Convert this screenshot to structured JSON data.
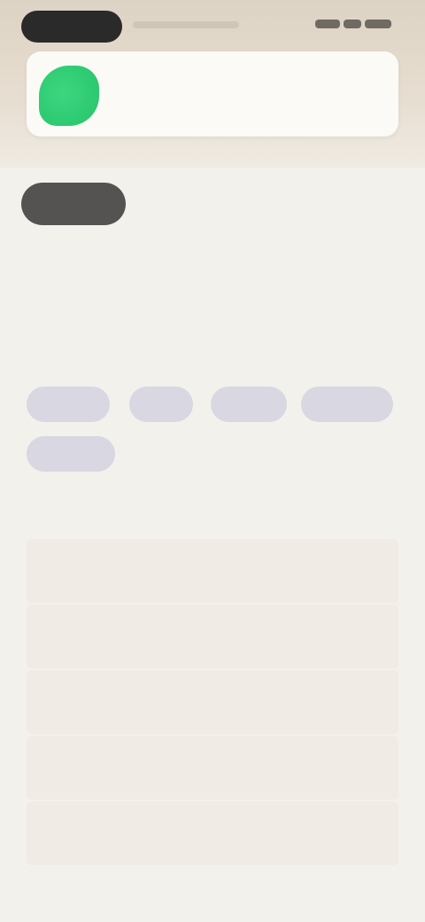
{
  "status_bar": {
    "time": "",
    "signal_icon": "signal-icon",
    "wifi_icon": "wifi-icon",
    "battery_icon": "battery-icon"
  },
  "app_card": {
    "name": "",
    "subtitle": "",
    "icon": "app-icon",
    "actions": [
      "",
      ""
    ]
  },
  "tabs": [
    {
      "label": "",
      "active": true
    },
    {
      "label": "",
      "active": false
    },
    {
      "label": "",
      "active": false
    }
  ],
  "description": "",
  "filters": {
    "label": "",
    "chips": [
      "",
      "",
      "",
      "",
      ""
    ]
  },
  "details": {
    "title": "",
    "rows": [
      {
        "label": "",
        "value": ""
      },
      {
        "label": "",
        "value": ""
      },
      {
        "label": "",
        "value": ""
      },
      {
        "label": "",
        "value": ""
      },
      {
        "label": "",
        "value": ""
      }
    ]
  },
  "colors": {
    "background": "#f3f1eb",
    "accent": "#25c46a",
    "active_tab": "#555352",
    "chip": "#d8d7e2"
  }
}
